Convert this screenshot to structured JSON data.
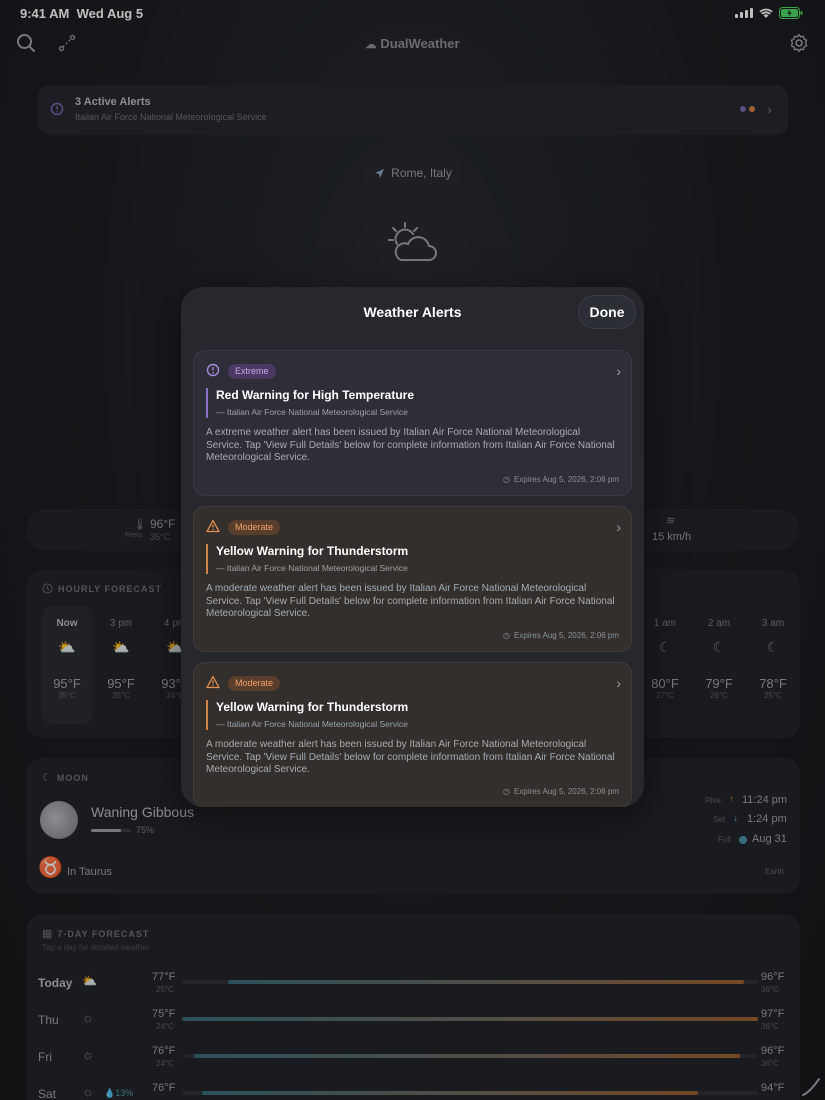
{
  "status_bar": {
    "time": "9:41 AM",
    "date": "Wed Aug 5"
  },
  "app": {
    "title": "DualWeather"
  },
  "alerts_banner": {
    "title": "3 Active Alerts",
    "source": "Italian Air Force National Meteorological Service",
    "dot_colors": [
      "#7a6bb0",
      "#d0834a"
    ]
  },
  "location": "Rome, Italy",
  "conditions": {
    "feels_f": "96°F",
    "feels_label": "Feels",
    "feels_c": "35°C",
    "wind": "15 km/h"
  },
  "hourly": {
    "label": "HOURLY FORECAST",
    "items": [
      {
        "time": "Now",
        "f": "95°F",
        "c": "35°C"
      },
      {
        "time": "3 pm",
        "f": "95°F",
        "c": "35°C"
      },
      {
        "time": "4 pm",
        "f": "93°F",
        "c": "34°C"
      },
      {
        "time": "1 am",
        "f": "80°F",
        "c": "27°C"
      },
      {
        "time": "2 am",
        "f": "79°F",
        "c": "26°C"
      },
      {
        "time": "3 am",
        "f": "78°F",
        "c": "25°C"
      }
    ]
  },
  "moon": {
    "label": "MOON",
    "phase": "Waning Gibbous",
    "illumination": "75%",
    "illumination_fraction": 0.75,
    "rise_label": "Rise",
    "rise": "11:24 pm",
    "set_label": "Set",
    "set": "1:24 pm",
    "full_label": "Full",
    "full": "Aug 31",
    "sign": "In Taurus",
    "ref": "Earth"
  },
  "seven_day": {
    "label": "7-DAY FORECAST",
    "hint": "Tap a day for detailed weather",
    "days": [
      {
        "day": "Today",
        "low_f": "77°F",
        "low_c": "25°C",
        "high_f": "96°F",
        "high_c": "36°C",
        "precip": ""
      },
      {
        "day": "Thu",
        "low_f": "75°F",
        "low_c": "24°C",
        "high_f": "97°F",
        "high_c": "36°C",
        "precip": ""
      },
      {
        "day": "Fri",
        "low_f": "76°F",
        "low_c": "24°C",
        "high_f": "96°F",
        "high_c": "36°C",
        "precip": ""
      },
      {
        "day": "Sat",
        "low_f": "76°F",
        "low_c": "24°C",
        "high_f": "94°F",
        "high_c": "34°C",
        "precip": "13%"
      }
    ]
  },
  "modal": {
    "title": "Weather Alerts",
    "done_label": "Done",
    "alerts": [
      {
        "severity": "Extreme",
        "title": "Red Warning for High Temperature",
        "source": "— Italian Air Force National Meteorological Service",
        "body": "A extreme weather alert has been issued by Italian Air Force National Meteorological Service. Tap 'View Full Details' below for complete information from Italian Air Force National Meteorological Service.",
        "expires": "Expires Aug 5, 2026, 2:06 pm",
        "accent": "#8b6fc2"
      },
      {
        "severity": "Moderate",
        "title": "Yellow Warning for Thunderstorm",
        "source": "— Italian Air Force National Meteorological Service",
        "body": "A moderate weather alert has been issued by Italian Air Force National Meteorological Service. Tap 'View Full Details' below for complete information from Italian Air Force National Meteorological Service.",
        "expires": "Expires Aug 5, 2026, 2:06 pm",
        "accent": "#d0834a"
      },
      {
        "severity": "Moderate",
        "title": "Yellow Warning for Thunderstorm",
        "source": "— Italian Air Force National Meteorological Service",
        "body": "A moderate weather alert has been issued by Italian Air Force National Meteorological Service. Tap 'View Full Details' below for complete information from Italian Air Force National Meteorological Service.",
        "expires": "Expires Aug 5, 2026, 2:06 pm",
        "accent": "#d0834a"
      }
    ]
  }
}
